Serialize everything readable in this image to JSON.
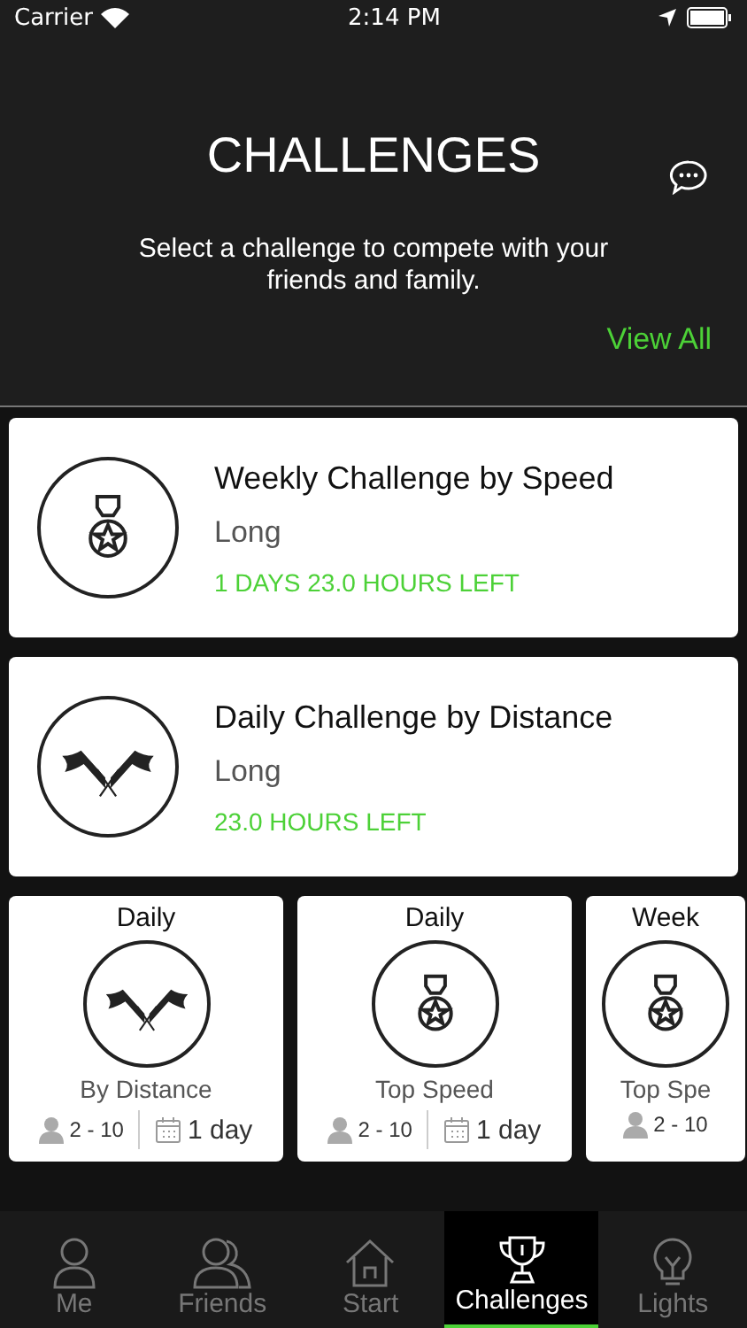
{
  "status_bar": {
    "carrier": "Carrier",
    "time": "2:14 PM"
  },
  "header": {
    "title": "CHALLENGES",
    "subtitle": "Select a challenge to compete with your friends and family.",
    "view_all": "View All"
  },
  "challenges": [
    {
      "kind": "medal",
      "title": "Weekly Challenge by Speed",
      "length": "Long",
      "time_left": "1 DAYS 23.0 HOURS LEFT"
    },
    {
      "kind": "flags",
      "title": "Daily Challenge by Distance",
      "length": "Long",
      "time_left": "23.0 HOURS LEFT"
    }
  ],
  "templates": [
    {
      "kind": "flags",
      "period": "Daily",
      "type": "By Distance",
      "players": "2 - 10",
      "duration": "1 day"
    },
    {
      "kind": "medal",
      "period": "Daily",
      "type": "Top Speed",
      "players": "2 - 10",
      "duration": "1 day"
    },
    {
      "kind": "medal",
      "period": "Week",
      "type": "Top Spe",
      "players": "2 - 10"
    }
  ],
  "tabs": [
    {
      "label": "Me",
      "selected": false
    },
    {
      "label": "Friends",
      "selected": false
    },
    {
      "label": "Start",
      "selected": false
    },
    {
      "label": "Challenges",
      "selected": true
    },
    {
      "label": "Lights",
      "selected": false
    }
  ]
}
